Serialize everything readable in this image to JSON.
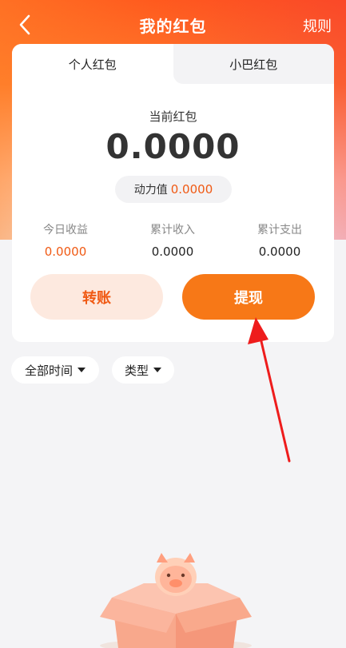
{
  "header": {
    "title": "我的红包",
    "rules_label": "规则",
    "back_icon": "chevron-left-icon"
  },
  "tabs": [
    {
      "label": "个人红包",
      "active": true
    },
    {
      "label": "小巴红包",
      "active": false
    }
  ],
  "balance": {
    "label": "当前红包",
    "value": "0.0000"
  },
  "power": {
    "label": "动力值",
    "value": "0.0000"
  },
  "stats": [
    {
      "label": "今日收益",
      "value": "0.0000",
      "highlight": true
    },
    {
      "label": "累计收入",
      "value": "0.0000",
      "highlight": false
    },
    {
      "label": "累计支出",
      "value": "0.0000",
      "highlight": false
    }
  ],
  "actions": {
    "transfer_label": "转账",
    "withdraw_label": "提现"
  },
  "filters": {
    "time_label": "全部时间",
    "type_label": "类型"
  },
  "colors": {
    "accent": "#f05a14",
    "primary_button": "#f77817",
    "secondary_button": "#fde9df",
    "annotation_arrow": "#ee1c1c"
  }
}
